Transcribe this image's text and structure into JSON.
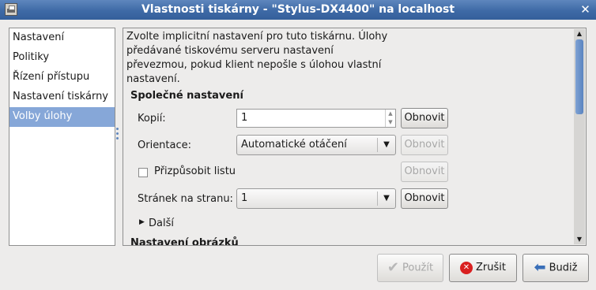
{
  "window": {
    "title": "Vlastnosti tiskárny - \"Stylus-DX4400\" na localhost",
    "close_glyph": "✕"
  },
  "sidebar": {
    "items": [
      {
        "label": "Nastavení",
        "selected": false
      },
      {
        "label": "Politiky",
        "selected": false
      },
      {
        "label": "Řízení přístupu",
        "selected": false
      },
      {
        "label": "Nastavení tiskárny",
        "selected": false
      },
      {
        "label": "Volby úlohy",
        "selected": true
      }
    ]
  },
  "main": {
    "intro_lines": [
      "Zvolte implicitní nastavení pro tuto tiskárnu. Úlohy",
      "předávané tiskovému serveru nastavení",
      "převezmou, pokud klient nepošle s úlohou vlastní",
      "nastavení."
    ],
    "common_section": "Společné nastavení",
    "copies": {
      "label": "Kopií:",
      "value": "1",
      "reset": "Obnovit",
      "reset_enabled": true
    },
    "orientation": {
      "label": "Orientace:",
      "value": "Automatické otáčení",
      "reset": "Obnovit",
      "reset_enabled": false
    },
    "fit_page": {
      "label": "Přizpůsobit listu",
      "checked": false,
      "reset": "Obnovit",
      "reset_enabled": false
    },
    "pages_per_side": {
      "label": "Stránek na stranu:",
      "value": "1",
      "reset": "Obnovit",
      "reset_enabled": true
    },
    "more": {
      "label": "Další",
      "arrow": "▶"
    },
    "image_section": "Nastavení obrázků"
  },
  "footer": {
    "apply": {
      "label": "Použít",
      "enabled": false,
      "icon": "check-icon"
    },
    "cancel": {
      "label": "Zrušit",
      "enabled": true,
      "icon": "cancel-icon"
    },
    "ok": {
      "label": "Budiž",
      "enabled": true,
      "icon": "back-arrow-icon"
    }
  }
}
